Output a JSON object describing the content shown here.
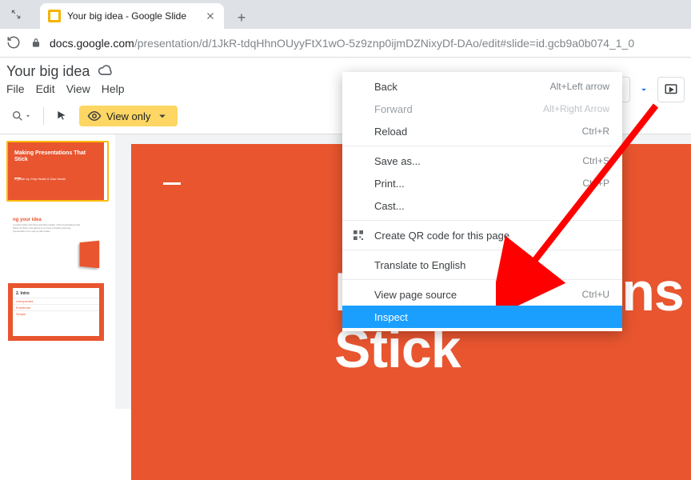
{
  "browser": {
    "tab_title": "Your big idea - Google Slide",
    "url_host": "docs.google.com",
    "url_path": "/presentation/d/1JkR-tdqHhnOUyyFtX1wO-5z9znp0ijmDZNixyDf-DAo/edit#slide=id.gcb9a0b074_1_0"
  },
  "doc": {
    "title": "Your big idea",
    "menus": [
      "File",
      "Edit",
      "View",
      "Help"
    ],
    "view_only_label": "View only"
  },
  "slide_main": {
    "title_line1": "Presentations",
    "title_line2": "Stick"
  },
  "thumbs": {
    "t1": {
      "title": "Making Presentations That Stick",
      "subtitle": "A guide by Chip Heath & Dan Heath"
    },
    "t2": {
      "title": "ng your idea",
      "text": "In partnership with Chip and Dan Heath, of the bestselling book Made To Stick, this advice is on how to build a winning presentation of a new product idea."
    },
    "t3": {
      "title": "2. Intro",
      "rows": [
        "Unexpected",
        "Emotional",
        "Simple"
      ]
    }
  },
  "context_menu": [
    {
      "label": "Back",
      "shortcut": "Alt+Left arrow",
      "disabled": false
    },
    {
      "label": "Forward",
      "shortcut": "Alt+Right Arrow",
      "disabled": true
    },
    {
      "label": "Reload",
      "shortcut": "Ctrl+R",
      "disabled": false
    },
    {
      "sep": true
    },
    {
      "label": "Save as...",
      "shortcut": "Ctrl+S",
      "disabled": false
    },
    {
      "label": "Print...",
      "shortcut": "Ctrl+P",
      "disabled": false
    },
    {
      "label": "Cast...",
      "shortcut": "",
      "disabled": false
    },
    {
      "sep": true
    },
    {
      "label": "Create QR code for this page",
      "shortcut": "",
      "disabled": false,
      "icon": "qr"
    },
    {
      "sep": true
    },
    {
      "label": "Translate to English",
      "shortcut": "",
      "disabled": false
    },
    {
      "sep": true
    },
    {
      "label": "View page source",
      "shortcut": "Ctrl+U",
      "disabled": false
    },
    {
      "label": "Inspect",
      "shortcut": "",
      "disabled": false,
      "hover": true
    }
  ]
}
